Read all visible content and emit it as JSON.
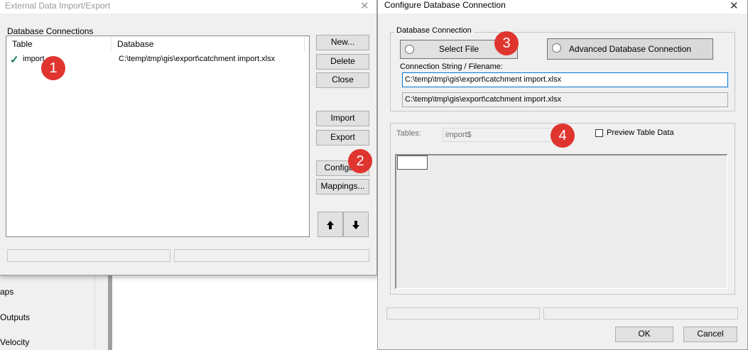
{
  "background": {
    "left_items": [
      "aps",
      "Outputs",
      "Velocity"
    ]
  },
  "dialog1": {
    "title": "External Data Import/Export",
    "group_label": "Database Connections",
    "columns": [
      "Table",
      "Database"
    ],
    "rows": [
      {
        "check": "✓",
        "table": "import",
        "database": "C:\\temp\\tmp\\gis\\export\\catchment import.xlsx"
      }
    ],
    "buttons": {
      "new": "New...",
      "delete": "Delete",
      "close": "Close",
      "import": "Import",
      "export": "Export",
      "configure": "Configure",
      "mappings": "Mappings..."
    },
    "move_up_icon": "arrow-up-icon",
    "move_down_icon": "arrow-down-icon"
  },
  "dialog2": {
    "title": "Configure Database Connection",
    "group_label": "Database Connection",
    "select_file": "Select File",
    "advanced": "Advanced Database Connection",
    "conn_label": "Connection String / Filename:",
    "conn_value": "C:\\temp\\tmp\\gis\\export\\catchment import.xlsx",
    "conn_value_readonly": "C:\\temp\\tmp\\gis\\export\\catchment import.xlsx",
    "tables_label": "Tables:",
    "tables_value": "import$",
    "preview_label": "Preview Table Data",
    "ok": "OK",
    "cancel": "Cancel"
  },
  "close_glyph": "✕",
  "badges": [
    "1",
    "2",
    "3",
    "4"
  ],
  "colors": {
    "badge": "#e0342f",
    "check": "#1f7a5a",
    "focus_border": "#0078d7"
  }
}
